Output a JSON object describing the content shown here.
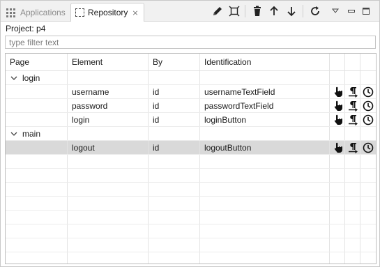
{
  "tabs": {
    "applications": {
      "label": "Applications"
    },
    "repository": {
      "label": "Repository",
      "close_glyph": "⨯"
    }
  },
  "toolbar": {
    "icons": [
      "pencil-icon",
      "focus-frame-icon",
      "trash-icon",
      "arrow-up-icon",
      "arrow-down-icon",
      "refresh-icon",
      "view-menu-icon",
      "minimize-icon",
      "maximize-icon"
    ]
  },
  "project": {
    "label": "Project: p4"
  },
  "filter": {
    "placeholder": "type filter text",
    "value": ""
  },
  "table": {
    "columns": [
      "Page",
      "Element",
      "By",
      "Identification"
    ],
    "groups": [
      {
        "page": "login",
        "expanded": true,
        "elements": [
          {
            "element": "username",
            "by": "id",
            "identification": "usernameTextField"
          },
          {
            "element": "password",
            "by": "id",
            "identification": "passwordTextField"
          },
          {
            "element": "login",
            "by": "id",
            "identification": "loginButton"
          }
        ]
      },
      {
        "page": "main",
        "expanded": true,
        "elements": [
          {
            "element": "logout",
            "by": "id",
            "identification": "logoutButton",
            "selected": true
          }
        ]
      }
    ],
    "row_actions": [
      "tap-hand-icon",
      "paragraph-arrow-icon",
      "clock-icon"
    ]
  },
  "colors": {
    "selected_row": "#d9d9d9",
    "grid_line": "#e3e3e3",
    "border": "#bdbdbd"
  }
}
